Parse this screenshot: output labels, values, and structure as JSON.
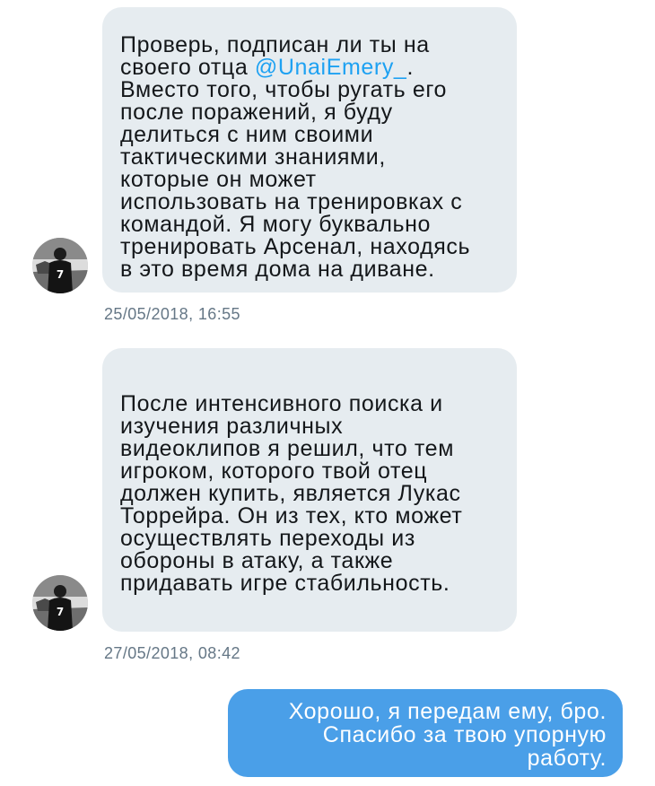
{
  "conversation": {
    "messages": [
      {
        "direction": "incoming",
        "avatar_icon": "player-number-7-avatar",
        "text_before_mention": "Проверь, подписан ли ты на\nсвоего отца ",
        "mention": "@UnaiEmery_",
        "text_after_mention": ".\nВместо того, чтобы ругать его\nпосле поражений, я буду\nделиться с ним своими\nтактическими знаниями,\nкоторые он может\nиспользовать на тренировках с\nкомандой. Я могу буквально\nтренировать Арсенал, находясь\nв это время дома на диване.",
        "timestamp": "25/05/2018, 16:55"
      },
      {
        "direction": "incoming",
        "avatar_icon": "player-number-7-avatar",
        "text": "После интенсивного поиска и\nизучения различных\nвидеоклипов я решил, что тем\nигроком, которого твой отец\nдолжен купить, является Лукас\nТоррейра. Он из тех, кто может\nосуществлять переходы из\nобороны в атаку, а также\nпридавать игре стабильность.",
        "timestamp": "27/05/2018, 08:42"
      },
      {
        "direction": "outgoing",
        "text": "Хорошо, я передам ему, бро.\nСпасибо за твою упорную\nработу."
      }
    ]
  },
  "colors": {
    "incoming_bubble": "#e6ecf0",
    "outgoing_bubble": "#4a9fe8",
    "mention": "#1da1f2",
    "timestamp": "#657786",
    "message_text": "#14171a"
  }
}
